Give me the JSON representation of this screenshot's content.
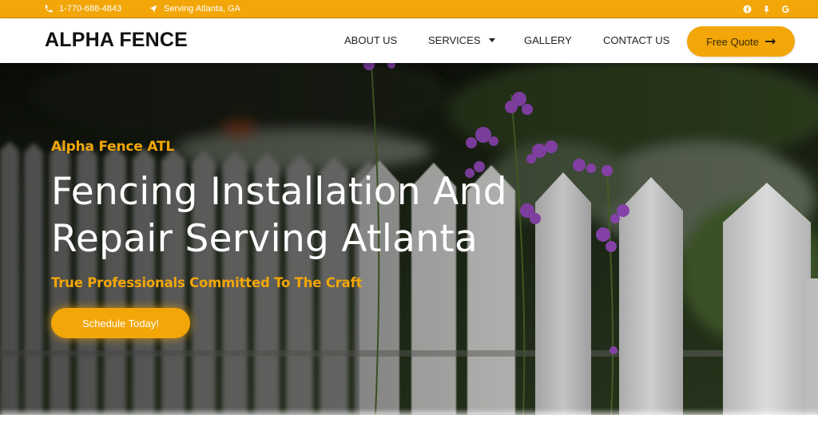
{
  "topbar": {
    "phone": "1-770-688-4843",
    "phone_icon": "phone-icon",
    "location": "Serving Atlanta, GA",
    "location_icon": "location-arrow-icon",
    "social": [
      {
        "name": "facebook-icon"
      },
      {
        "name": "pin-icon"
      },
      {
        "name": "google-icon"
      }
    ]
  },
  "header": {
    "logo": "ALPHA FENCE",
    "nav": [
      {
        "label": "ABOUT US"
      },
      {
        "label": "SERVICES",
        "has_dropdown": true
      },
      {
        "label": "GALLERY"
      },
      {
        "label": "CONTACT US"
      }
    ],
    "cta_label": "Free Quote",
    "cta_icon": "arrow-right-icon"
  },
  "hero": {
    "eyebrow": "Alpha Fence ATL",
    "headline_line1": "Fencing Installation And",
    "headline_line2": "Repair Serving Atlanta",
    "tagline": "True Professionals Committed To The Craft",
    "button_label": "Schedule Today!"
  },
  "colors": {
    "accent": "#f2a608",
    "header_bg": "#ffffff",
    "text_dark": "#222222"
  }
}
